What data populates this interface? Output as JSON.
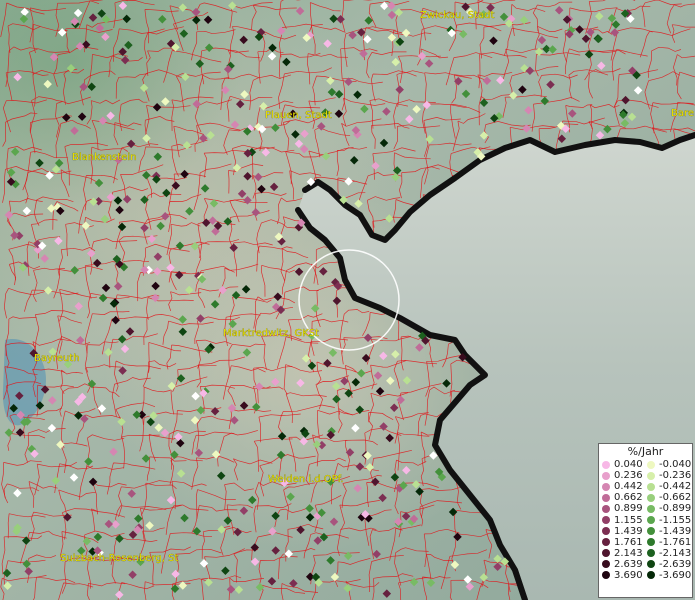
{
  "map": {
    "labels": [
      {
        "name": "zwickau",
        "text": "Zwickau, Stadt"
      },
      {
        "name": "plauen",
        "text": "Plauen, Stadt"
      },
      {
        "name": "blankenstein",
        "text": "Blankenstein"
      },
      {
        "name": "bayreuth",
        "text": "Bayreuth"
      },
      {
        "name": "marktredwitz",
        "text": "Marktredwitz, GKSt"
      },
      {
        "name": "weiden",
        "text": "Weiden i.d.OPf."
      },
      {
        "name": "sulzbach",
        "text": "Sulzbach-Rosenberg, St"
      },
      {
        "name": "bare",
        "text": "Bare"
      }
    ]
  },
  "legend": {
    "title": "%/Jahr",
    "positive": [
      {
        "value": "0.040",
        "color": "#f7b8e6"
      },
      {
        "value": "0.236",
        "color": "#e8a0cc"
      },
      {
        "value": "0.442",
        "color": "#d586b2"
      },
      {
        "value": "0.662",
        "color": "#c06c98"
      },
      {
        "value": "0.899",
        "color": "#a8547e"
      },
      {
        "value": "1.155",
        "color": "#923f67"
      },
      {
        "value": "1.439",
        "color": "#7c2e52"
      },
      {
        "value": "1.761",
        "color": "#66213f"
      },
      {
        "value": "2.143",
        "color": "#4f152e"
      },
      {
        "value": "2.639",
        "color": "#380c1e"
      },
      {
        "value": "3.690",
        "color": "#1f0410"
      }
    ],
    "negative": [
      {
        "value": "-0.040",
        "color": "#eef8c0"
      },
      {
        "value": "-0.236",
        "color": "#d6efaa"
      },
      {
        "value": "-0.442",
        "color": "#b8e092"
      },
      {
        "value": "-0.662",
        "color": "#98cf7c"
      },
      {
        "value": "-0.899",
        "color": "#78bb64"
      },
      {
        "value": "-1.155",
        "color": "#5ba64e"
      },
      {
        "value": "-1.439",
        "color": "#43903b"
      },
      {
        "value": "-1.761",
        "color": "#2e7a2c"
      },
      {
        "value": "-2.143",
        "color": "#1d611f"
      },
      {
        "value": "-2.639",
        "color": "#0f4512"
      },
      {
        "value": "-3.690",
        "color": "#052808"
      }
    ]
  }
}
